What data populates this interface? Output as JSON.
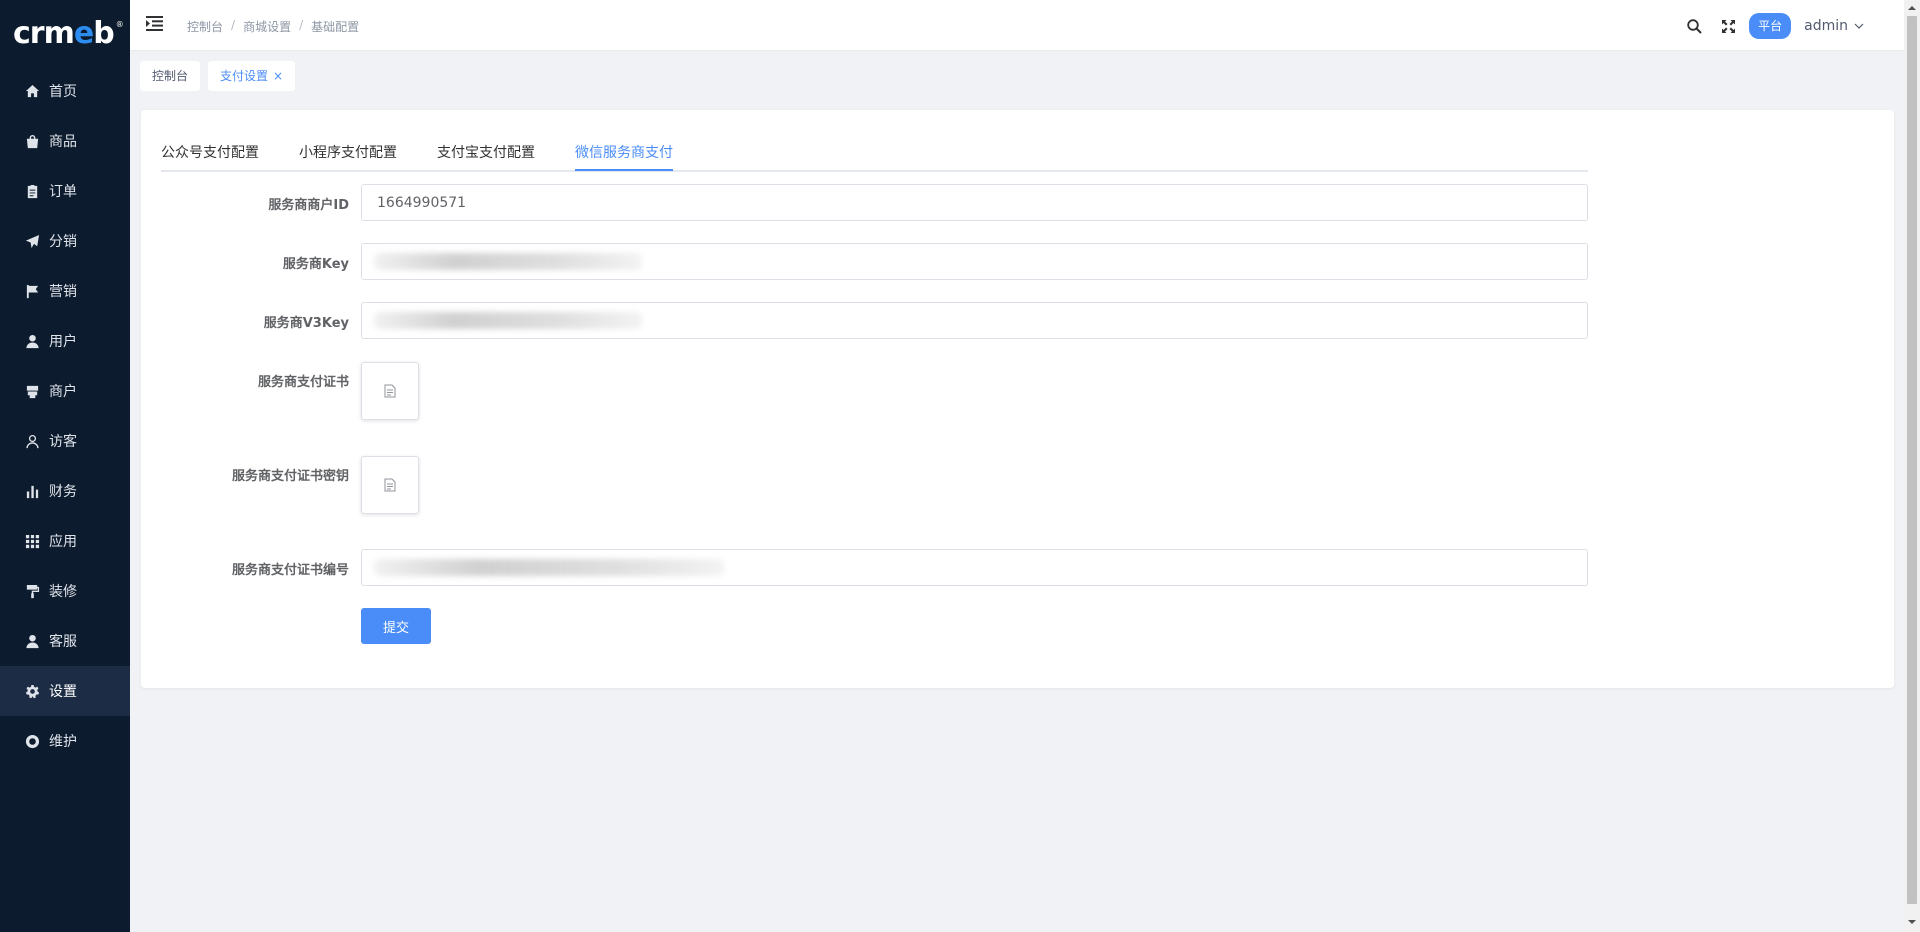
{
  "logo": {
    "text_part1": "crm",
    "text_part2": "e",
    "text_part3": "b",
    "reg": "®"
  },
  "sidebar": {
    "items": [
      {
        "label": "首页",
        "icon": "home-icon"
      },
      {
        "label": "商品",
        "icon": "bag-icon"
      },
      {
        "label": "订单",
        "icon": "clipboard-icon"
      },
      {
        "label": "分销",
        "icon": "send-icon"
      },
      {
        "label": "营销",
        "icon": "flag-icon"
      },
      {
        "label": "用户",
        "icon": "user-icon"
      },
      {
        "label": "商户",
        "icon": "store-icon"
      },
      {
        "label": "访客",
        "icon": "visitor-icon"
      },
      {
        "label": "财务",
        "icon": "bar-chart-icon"
      },
      {
        "label": "应用",
        "icon": "grid-icon"
      },
      {
        "label": "装修",
        "icon": "paint-roller-icon"
      },
      {
        "label": "客服",
        "icon": "service-user-icon"
      },
      {
        "label": "设置",
        "icon": "gear-icon"
      },
      {
        "label": "维护",
        "icon": "maintenance-icon"
      }
    ],
    "active_index": 12
  },
  "header": {
    "breadcrumb": [
      "控制台",
      "商城设置",
      "基础配置"
    ],
    "platform_badge": "平台",
    "user": "admin"
  },
  "tags": {
    "home": "控制台",
    "current": "支付设置",
    "close": "×"
  },
  "tabs": {
    "items": [
      "公众号支付配置",
      "小程序支付配置",
      "支付宝支付配置",
      "微信服务商支付"
    ],
    "active_index": 3
  },
  "form": {
    "merchant_id_label": "服务商商户ID",
    "merchant_id_value": "1664990571",
    "key_label": "服务商Key",
    "v3key_label": "服务商V3Key",
    "cert_label": "服务商支付证书",
    "cert_key_label": "服务商支付证书密钥",
    "cert_serial_label": "服务商支付证书编号",
    "submit_label": "提交"
  },
  "colors": {
    "sidebar_bg": "#0d1b2e",
    "accent": "#4a8df8",
    "page_bg": "#f0f2f5"
  }
}
